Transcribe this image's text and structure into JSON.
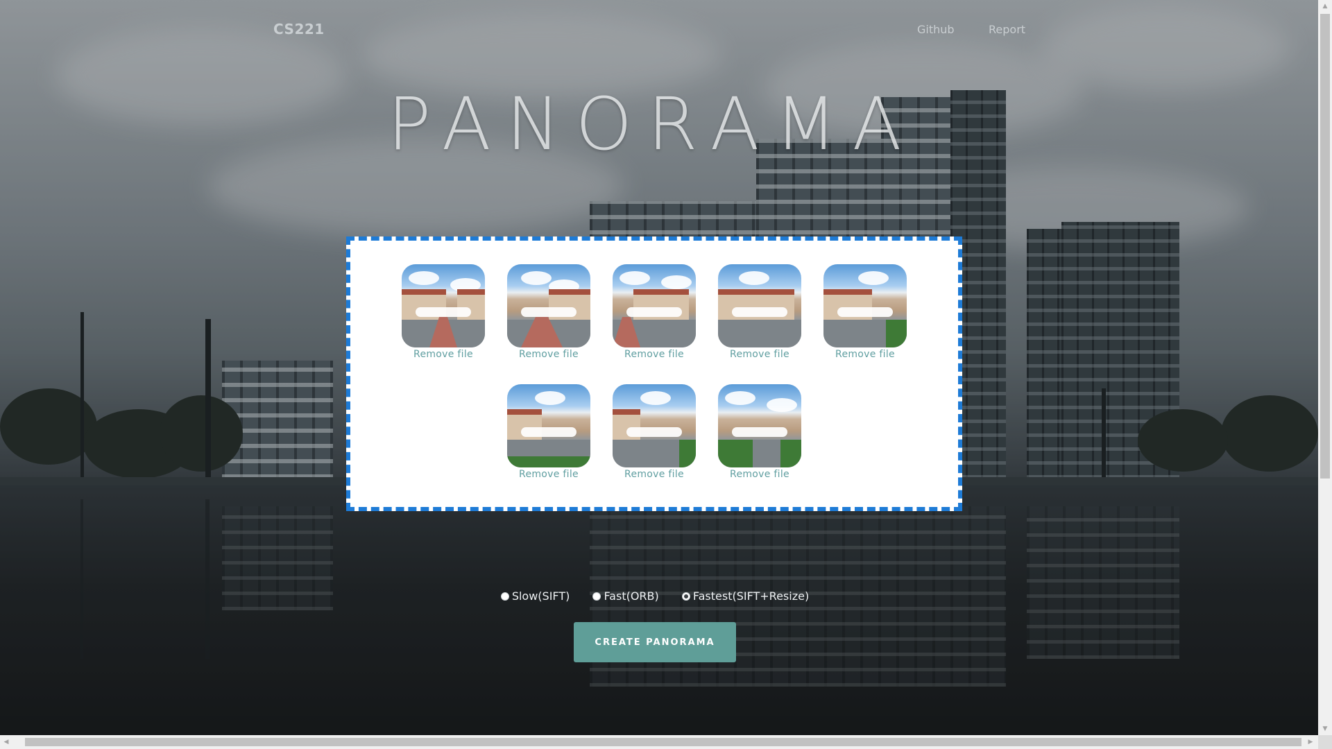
{
  "nav": {
    "brand": "CS221",
    "links": [
      "Github",
      "Report"
    ]
  },
  "hero": {
    "title": "PANORAMA"
  },
  "dropzone": {
    "files": [
      {
        "remove_label": "Remove file"
      },
      {
        "remove_label": "Remove file"
      },
      {
        "remove_label": "Remove file"
      },
      {
        "remove_label": "Remove file"
      },
      {
        "remove_label": "Remove file"
      },
      {
        "remove_label": "Remove file"
      },
      {
        "remove_label": "Remove file"
      },
      {
        "remove_label": "Remove file"
      }
    ]
  },
  "options": {
    "choices": [
      "Slow(SIFT)",
      "Fast(ORB)",
      "Fastest(SIFT+Resize)"
    ],
    "selected": "Fastest(SIFT+Resize)"
  },
  "actions": {
    "create_label": "CREATE PANORAMA"
  },
  "colors": {
    "accent": "#5f9e98",
    "dropzone_border": "#1e7bd6",
    "remove_link": "#5f9ea0"
  },
  "icons": {
    "radio": "radio-icon",
    "scroll_up": "scroll-up-arrow-icon",
    "scroll_down": "scroll-down-arrow-icon",
    "scroll_left": "scroll-left-arrow-icon",
    "scroll_right": "scroll-right-arrow-icon"
  }
}
